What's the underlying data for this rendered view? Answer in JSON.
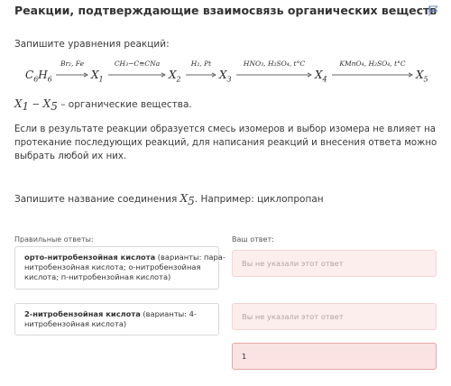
{
  "header": {
    "title": "Реакции, подтверждающие взаимосвязь органических веществ"
  },
  "task": {
    "instruction": "Запишите уравнения реакций:",
    "scheme": {
      "start_base": "C",
      "start_sub1": "6",
      "start_mid": "H",
      "start_sub2": "6",
      "x1": "X",
      "x1_sub": "1",
      "x2": "X",
      "x2_sub": "2",
      "x3": "X",
      "x3_sub": "3",
      "x4": "X",
      "x4_sub": "4",
      "x5": "X",
      "x5_sub": "5",
      "cond1": "Br₂, Fe",
      "cond2": "CH₃−C≡CNa",
      "cond3": "H₂, Pt",
      "cond4": "HNO₃, H₂SO₄, t°C",
      "cond5": "KMnO₄, H₂SO₄, t°C"
    },
    "x_note_a": "X",
    "x_note_a_sub": "1",
    "x_note_dash": " − ",
    "x_note_b": "X",
    "x_note_b_sub": "5",
    "x_note_text": " – органические вещества.",
    "paragraph_lines": [
      "Если в результате реакции образуется смесь изомеров и выбор изомера не влияет на",
      "протекание последующих реакций, для написания реакций и внесения ответа можно",
      "выбрать любой их них."
    ],
    "question_text": "Запишите название соединения ",
    "question_var": "X",
    "question_var_sub": "5",
    "question_tail": ". Например: циклопропан"
  },
  "answers": {
    "correct_label": "Правильные ответы:",
    "your_label": "Ваш ответ:",
    "correct": [
      {
        "bold": "орто-нитробензойная кислота",
        "line1_rest": " (варианты: пара-",
        "line2": "нитробензойная кислота; о-нитробензойная",
        "line3": "кислота; п-нитробензойная кислота)"
      },
      {
        "bold": "2-нитробензойная кислота",
        "line1_rest": " (варианты: 4-",
        "line2": "нитробензойная кислота)"
      }
    ],
    "inputs": [
      {
        "placeholder": "Вы не указали этот ответ",
        "value": ""
      },
      {
        "placeholder": "Вы не указали этот ответ",
        "value": ""
      },
      {
        "placeholder": "",
        "value": "1"
      }
    ]
  }
}
